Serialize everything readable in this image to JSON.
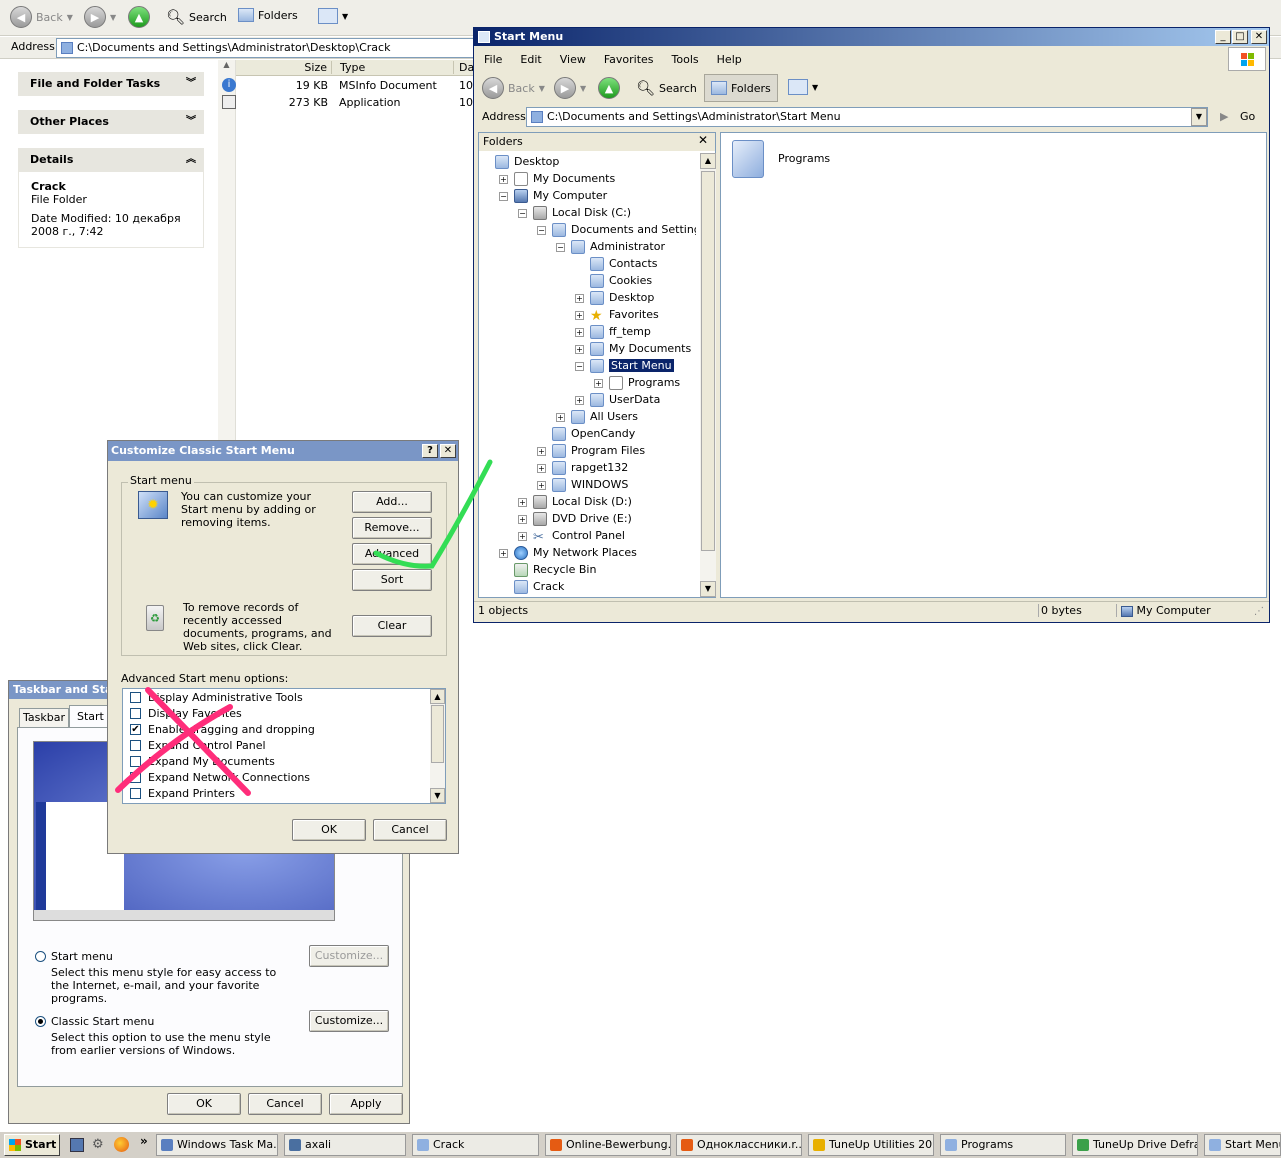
{
  "back_window": {
    "toolbar": {
      "back": "Back",
      "search": "Search",
      "folders": "Folders"
    },
    "address_label": "Address",
    "address": "C:\\Documents and Settings\\Administrator\\Desktop\\Crack",
    "tasks": {
      "file_folder": "File and Folder Tasks",
      "other_places": "Other Places",
      "details": "Details"
    },
    "details": {
      "name": "Crack",
      "kind": "File Folder",
      "modified": "Date Modified: 10 декабря 2008 г., 7:42"
    },
    "columns": {
      "size": "Size",
      "type": "Type",
      "date": "Da"
    },
    "files": [
      {
        "size": "19 KB",
        "type": "MSInfo Document",
        "date": "10"
      },
      {
        "size": "273 KB",
        "type": "Application",
        "date": "10"
      }
    ]
  },
  "start_menu_window": {
    "title": "Start Menu",
    "menu": [
      "File",
      "Edit",
      "View",
      "Favorites",
      "Tools",
      "Help"
    ],
    "toolbar": {
      "back": "Back",
      "search": "Search",
      "folders": "Folders"
    },
    "address_label": "Address",
    "address": "C:\\Documents and Settings\\Administrator\\Start Menu",
    "go": "Go",
    "folders_title": "Folders",
    "tree": [
      {
        "label": "Desktop",
        "indent": 0,
        "pm": "",
        "icon": "folder"
      },
      {
        "label": "My Documents",
        "indent": 1,
        "pm": "+",
        "icon": "doc"
      },
      {
        "label": "My Computer",
        "indent": 1,
        "pm": "−",
        "icon": "pc"
      },
      {
        "label": "Local Disk (C:)",
        "indent": 2,
        "pm": "−",
        "icon": "drive"
      },
      {
        "label": "Documents and Settings",
        "indent": 3,
        "pm": "−",
        "icon": "folder"
      },
      {
        "label": "Administrator",
        "indent": 4,
        "pm": "−",
        "icon": "folder"
      },
      {
        "label": "Contacts",
        "indent": 5,
        "pm": "",
        "icon": "folder"
      },
      {
        "label": "Cookies",
        "indent": 5,
        "pm": "",
        "icon": "folder"
      },
      {
        "label": "Desktop",
        "indent": 5,
        "pm": "+",
        "icon": "folder"
      },
      {
        "label": "Favorites",
        "indent": 5,
        "pm": "+",
        "icon": "star"
      },
      {
        "label": "ff_temp",
        "indent": 5,
        "pm": "+",
        "icon": "folder"
      },
      {
        "label": "My Documents",
        "indent": 5,
        "pm": "+",
        "icon": "folder"
      },
      {
        "label": "Start Menu",
        "indent": 5,
        "pm": "−",
        "icon": "folder",
        "selected": true
      },
      {
        "label": "Programs",
        "indent": 6,
        "pm": "+",
        "icon": "doc"
      },
      {
        "label": "UserData",
        "indent": 5,
        "pm": "+",
        "icon": "folder"
      },
      {
        "label": "All Users",
        "indent": 4,
        "pm": "+",
        "icon": "folder"
      },
      {
        "label": "OpenCandy",
        "indent": 3,
        "pm": "",
        "icon": "folder"
      },
      {
        "label": "Program Files",
        "indent": 3,
        "pm": "+",
        "icon": "folder"
      },
      {
        "label": "rapget132",
        "indent": 3,
        "pm": "+",
        "icon": "folder"
      },
      {
        "label": "WINDOWS",
        "indent": 3,
        "pm": "+",
        "icon": "folder"
      },
      {
        "label": "Local Disk (D:)",
        "indent": 2,
        "pm": "+",
        "icon": "drive"
      },
      {
        "label": "DVD Drive (E:)",
        "indent": 2,
        "pm": "+",
        "icon": "drive"
      },
      {
        "label": "Control Panel",
        "indent": 2,
        "pm": "+",
        "icon": "cp"
      },
      {
        "label": "My Network Places",
        "indent": 1,
        "pm": "+",
        "icon": "net"
      },
      {
        "label": "Recycle Bin",
        "indent": 1,
        "pm": "",
        "icon": "bin"
      },
      {
        "label": "Crack",
        "indent": 1,
        "pm": "",
        "icon": "folder"
      }
    ],
    "content_item": "Programs",
    "status": {
      "objects": "1 objects",
      "size": "0 bytes",
      "location": "My Computer"
    }
  },
  "customize_dialog": {
    "title": "Customize Classic Start Menu",
    "help": "?",
    "close": "✕",
    "group_label": "Start menu",
    "intro": "You can customize your Start menu by adding or removing items.",
    "buttons": {
      "add": "Add...",
      "remove": "Remove...",
      "advanced": "Advanced",
      "sort": "Sort",
      "clear": "Clear",
      "ok": "OK",
      "cancel": "Cancel"
    },
    "clear_text": "To remove records of recently accessed documents, programs, and Web sites, click Clear.",
    "advanced_label": "Advanced Start menu options:",
    "options": [
      {
        "label": "Display Administrative Tools",
        "checked": false
      },
      {
        "label": "Display Favorites",
        "checked": false
      },
      {
        "label": "Enable dragging and dropping",
        "checked": true
      },
      {
        "label": "Expand Control Panel",
        "checked": false
      },
      {
        "label": "Expand My Documents",
        "checked": false
      },
      {
        "label": "Expand Network Connections",
        "checked": false
      },
      {
        "label": "Expand Printers",
        "checked": false
      }
    ]
  },
  "taskbar_dialog": {
    "title": "Taskbar and Star",
    "tabs": [
      "Taskbar",
      "Start M"
    ],
    "start_menu_option": {
      "label": "Start menu",
      "desc": "Select this menu style for easy access to the Internet, e-mail, and your favorite programs."
    },
    "classic_option": {
      "label": "Classic Start menu",
      "desc": "Select this option to use the menu style from earlier versions of Windows."
    },
    "customize": "Customize...",
    "buttons": {
      "ok": "OK",
      "cancel": "Cancel",
      "apply": "Apply"
    }
  },
  "taskbar": {
    "start": "Start",
    "chevron": "»",
    "tasks": [
      "Windows Task Ma...",
      "axali",
      "Crack",
      "Online-Bewerbung...",
      "Одноклассники.r...",
      "TuneUp Utilities 20...",
      "Programs",
      "TuneUp Drive Defrag",
      "Start Menu"
    ]
  },
  "annotation_colors": {
    "check": "#33dd55",
    "cross": "#ff2d7a"
  }
}
